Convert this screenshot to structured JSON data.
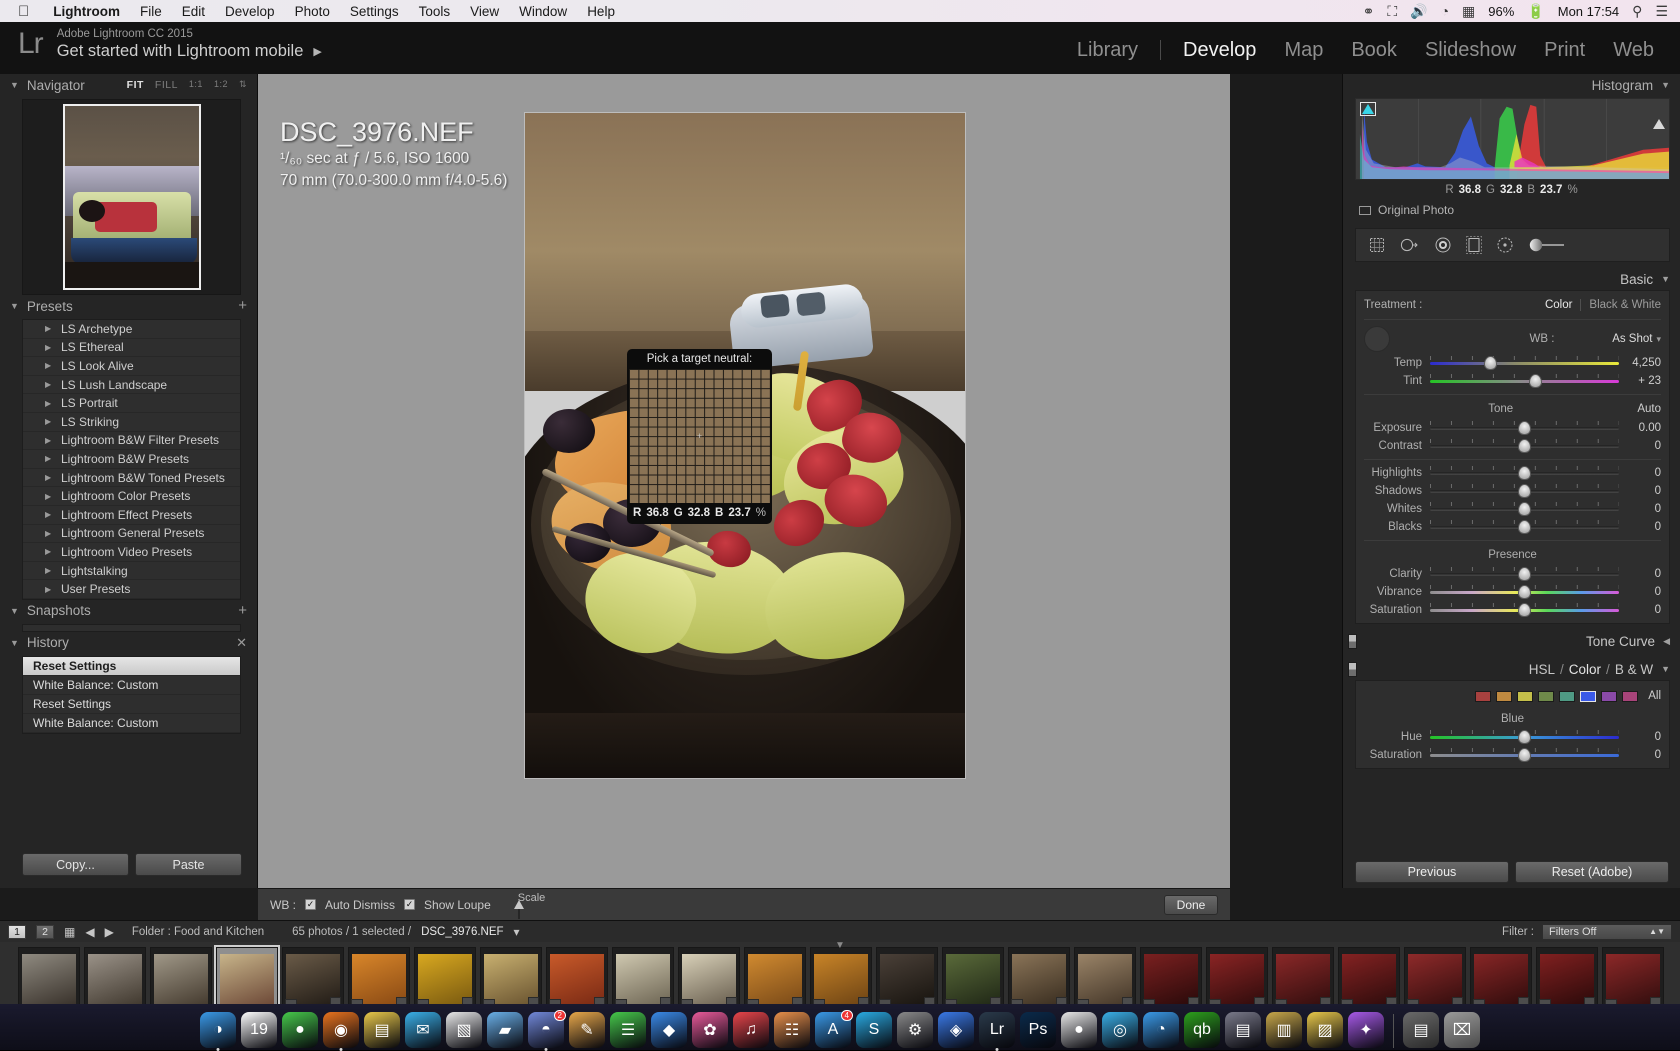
{
  "menubar": {
    "apple": "apple-logo",
    "items": [
      "Lightroom",
      "File",
      "Edit",
      "Develop",
      "Photo",
      "Settings",
      "Tools",
      "View",
      "Window",
      "Help"
    ],
    "status": {
      "battery": "96%",
      "time": "Mon 17:54"
    }
  },
  "identity": {
    "logo": "Lr",
    "line1": "Adobe Lightroom CC 2015",
    "line2": "Get started with Lightroom mobile",
    "arrow": "▶"
  },
  "modules": [
    "Library",
    "Develop",
    "Map",
    "Book",
    "Slideshow",
    "Print",
    "Web"
  ],
  "active_module": "Develop",
  "navigator": {
    "title": "Navigator",
    "modes": [
      "FIT",
      "FILL",
      "1:1",
      "1:2"
    ],
    "active_mode": "FIT"
  },
  "presets": {
    "title": "Presets",
    "items": [
      "LS Archetype",
      "LS Ethereal",
      "LS Look Alive",
      "LS Lush Landscape",
      "LS Portrait",
      "LS Striking",
      "Lightroom B&W Filter Presets",
      "Lightroom B&W Presets",
      "Lightroom B&W Toned Presets",
      "Lightroom Color Presets",
      "Lightroom Effect Presets",
      "Lightroom General Presets",
      "Lightroom Video Presets",
      "Lightstalking",
      "User Presets"
    ]
  },
  "snapshots": {
    "title": "Snapshots"
  },
  "history": {
    "title": "History",
    "items": [
      "Reset Settings",
      "White Balance: Custom",
      "Reset Settings",
      "White Balance: Custom"
    ],
    "selected_index": 0
  },
  "left_buttons": {
    "copy": "Copy...",
    "paste": "Paste"
  },
  "photo_info": {
    "filename": "DSC_3976.NEF",
    "exposure": "¹/₆₀ sec at ƒ / 5.6, ISO 1600",
    "lens": "70 mm (70.0-300.0 mm f/4.0-5.6)"
  },
  "loupe": {
    "title": "Pick a target neutral:",
    "r_label": "R",
    "r_value": "36.8",
    "g_label": "G",
    "g_value": "32.8",
    "b_label": "B",
    "b_value": "23.7",
    "unit": "%"
  },
  "wb_toolbar": {
    "label": "WB :",
    "auto_dismiss": "Auto Dismiss",
    "show_loupe": "Show Loupe",
    "scale": "Scale",
    "done": "Done"
  },
  "histogram": {
    "title": "Histogram",
    "r_label": "R",
    "r_value": "36.8",
    "g_label": "G",
    "g_value": "32.8",
    "b_label": "B",
    "b_value": "23.7",
    "unit": "%",
    "original_photo": "Original Photo"
  },
  "tools": [
    "crop-overlay-icon",
    "spot-removal-icon",
    "red-eye-icon",
    "graduated-filter-icon",
    "radial-filter-icon",
    "adjustment-brush-icon"
  ],
  "basic": {
    "title": "Basic",
    "treatment_label": "Treatment :",
    "treatment_color": "Color",
    "treatment_bw": "Black & White",
    "wb_label": "WB :",
    "wb_value": "As Shot",
    "sliders": [
      {
        "name": "Temp",
        "value": "4,250",
        "pos": 32,
        "track": "temp"
      },
      {
        "name": "Tint",
        "value": "+ 23",
        "pos": 56,
        "track": "tint"
      }
    ],
    "tone_label": "Tone",
    "auto_label": "Auto",
    "tone_sliders": [
      {
        "name": "Exposure",
        "value": "0.00",
        "pos": 50,
        "track": ""
      },
      {
        "name": "Contrast",
        "value": "0",
        "pos": 50,
        "track": ""
      },
      {
        "name": "Highlights",
        "value": "0",
        "pos": 50,
        "track": ""
      },
      {
        "name": "Shadows",
        "value": "0",
        "pos": 50,
        "track": ""
      },
      {
        "name": "Whites",
        "value": "0",
        "pos": 50,
        "track": ""
      },
      {
        "name": "Blacks",
        "value": "0",
        "pos": 50,
        "track": ""
      }
    ],
    "presence_label": "Presence",
    "presence_sliders": [
      {
        "name": "Clarity",
        "value": "0",
        "pos": 50,
        "track": ""
      },
      {
        "name": "Vibrance",
        "value": "0",
        "pos": 50,
        "track": "vib"
      },
      {
        "name": "Saturation",
        "value": "0",
        "pos": 50,
        "track": "sat"
      }
    ]
  },
  "tone_curve": {
    "title": "Tone Curve"
  },
  "hsl": {
    "title_hsl": "HSL",
    "sep1": "/",
    "title_color": "Color",
    "sep2": "/",
    "title_bw": "B & W",
    "all_label": "All",
    "swatches": [
      "#a8413f",
      "#c08a40",
      "#c4bf4a",
      "#6f8a4a",
      "#4f9a84",
      "#3a5ae8",
      "#8a4aa8",
      "#a8447a"
    ],
    "selected_swatch_index": 5,
    "channel_label": "Blue",
    "sliders": [
      {
        "name": "Hue",
        "value": "0",
        "pos": 50,
        "track": "hue"
      },
      {
        "name": "Saturation",
        "value": "0",
        "pos": 50,
        "track": "bsat"
      }
    ]
  },
  "right_buttons": {
    "previous": "Previous",
    "reset": "Reset (Adobe)"
  },
  "filmstrip_bar": {
    "page1": "1",
    "page2": "2",
    "grid_icon": "grid-view-icon",
    "back_icon": "back-arrow-icon",
    "forward_icon": "forward-arrow-icon",
    "folder_label": "Folder : Food and Kitchen",
    "count_text": "65 photos / 1 selected /",
    "selected_file": "DSC_3976.NEF",
    "filter_label": "Filter :",
    "filter_value": "Filters Off"
  },
  "filmstrip": {
    "thumbs": [
      {
        "c1": "#8f8a80",
        "c2": "#3a332c",
        "badge": false
      },
      {
        "c1": "#9a9288",
        "c2": "#423a30",
        "badge": false
      },
      {
        "c1": "#a09888",
        "c2": "#463c30",
        "badge": false
      },
      {
        "c1": "#c7b48a",
        "c2": "#6e4a38",
        "badge": false,
        "current": true
      },
      {
        "c1": "#6a5b48",
        "c2": "#221c16",
        "badge": true
      },
      {
        "c1": "#d8862a",
        "c2": "#8a4a14",
        "badge": true
      },
      {
        "c1": "#d8a820",
        "c2": "#7a5a10",
        "badge": true
      },
      {
        "c1": "#c8b070",
        "c2": "#6a5430",
        "badge": true
      },
      {
        "c1": "#c85a2a",
        "c2": "#7a2a14",
        "badge": true
      },
      {
        "c1": "#cfc8b0",
        "c2": "#6e6654",
        "badge": true
      },
      {
        "c1": "#d8d0b8",
        "c2": "#6a6050",
        "badge": true
      },
      {
        "c1": "#d08a30",
        "c2": "#7a4a18",
        "badge": true
      },
      {
        "c1": "#c88428",
        "c2": "#6e4414",
        "badge": true
      },
      {
        "c1": "#4a4038",
        "c2": "#18140f",
        "badge": true
      },
      {
        "c1": "#5a6a3a",
        "c2": "#202816",
        "badge": true
      },
      {
        "c1": "#8a7458",
        "c2": "#3a2e20",
        "badge": true
      },
      {
        "c1": "#9a8468",
        "c2": "#443628",
        "badge": true
      },
      {
        "c1": "#7a2020",
        "c2": "#2a0a0a",
        "badge": true
      },
      {
        "c1": "#8a2424",
        "c2": "#300c0c",
        "badge": true
      },
      {
        "c1": "#8a2828",
        "c2": "#320e0e",
        "badge": true
      },
      {
        "c1": "#842222",
        "c2": "#2e0c0c",
        "badge": true
      },
      {
        "c1": "#8e2a2a",
        "c2": "#340e0e",
        "badge": true
      },
      {
        "c1": "#882626",
        "c2": "#300c0c",
        "badge": true
      },
      {
        "c1": "#802020",
        "c2": "#2c0a0a",
        "badge": true
      },
      {
        "c1": "#8c2828",
        "c2": "#320e0e",
        "badge": true
      }
    ]
  },
  "dock": {
    "items": [
      {
        "name": "finder",
        "glyph": "◑",
        "color": "#3a9ae8",
        "dot": true
      },
      {
        "name": "calendar",
        "glyph": "19",
        "color": "#ffffff",
        "dot": false
      },
      {
        "name": "messages",
        "glyph": "●",
        "color": "#46c84a",
        "dot": false
      },
      {
        "name": "firefox",
        "glyph": "◉",
        "color": "#e8731e",
        "dot": true
      },
      {
        "name": "notes",
        "glyph": "▤",
        "color": "#e8c84a",
        "dot": false
      },
      {
        "name": "mail",
        "glyph": "✉",
        "color": "#3ab0e8",
        "dot": false
      },
      {
        "name": "textedit",
        "glyph": "▧",
        "color": "#e8e8e8",
        "dot": false
      },
      {
        "name": "folder",
        "glyph": "▰",
        "color": "#6ab0e8",
        "dot": false
      },
      {
        "name": "discord",
        "glyph": "◓",
        "color": "#7289da",
        "dot": true,
        "badge": "2"
      },
      {
        "name": "pages",
        "glyph": "✎",
        "color": "#e8a84a",
        "dot": false
      },
      {
        "name": "numbers",
        "glyph": "☰",
        "color": "#46c84a",
        "dot": false
      },
      {
        "name": "keynote",
        "glyph": "◆",
        "color": "#3a8ae8",
        "dot": false
      },
      {
        "name": "photos",
        "glyph": "✿",
        "color": "#e85a9a",
        "dot": false
      },
      {
        "name": "itunes",
        "glyph": "♫",
        "color": "#e8454a",
        "dot": false
      },
      {
        "name": "ibooks",
        "glyph": "☷",
        "color": "#e8904a",
        "dot": false
      },
      {
        "name": "appstore",
        "glyph": "A",
        "color": "#3a9ae8",
        "dot": false,
        "badge": "4"
      },
      {
        "name": "skype",
        "glyph": "S",
        "color": "#29aae1",
        "dot": false
      },
      {
        "name": "settings",
        "glyph": "⚙",
        "color": "#8a8a8a",
        "dot": false
      },
      {
        "name": "dropbox",
        "glyph": "◈",
        "color": "#3a7ae8",
        "dot": false
      },
      {
        "name": "lightroom",
        "glyph": "Lr",
        "color": "#2a3a4a",
        "dot": true
      },
      {
        "name": "photoshop",
        "glyph": "Ps",
        "color": "#0a2a4a",
        "dot": false
      },
      {
        "name": "chrome",
        "glyph": "●",
        "color": "#e8e8e8",
        "dot": false
      },
      {
        "name": "safari",
        "glyph": "◎",
        "color": "#3ab0e8",
        "dot": false
      },
      {
        "name": "edge",
        "glyph": "◔",
        "color": "#3a9ae8",
        "dot": false
      },
      {
        "name": "quickbooks",
        "glyph": "qb",
        "color": "#2ca01c",
        "dot": false
      },
      {
        "name": "docs",
        "glyph": "▤",
        "color": "#7a7a8a",
        "dot": false
      },
      {
        "name": "notebook",
        "glyph": "▥",
        "color": "#c8a84a",
        "dot": false
      },
      {
        "name": "stickies",
        "glyph": "▨",
        "color": "#e8c84a",
        "dot": false
      },
      {
        "name": "preview",
        "glyph": "✦",
        "color": "#a85ae8",
        "dot": false
      }
    ],
    "trash": "🗑",
    "downloads": "downloads-stack"
  }
}
